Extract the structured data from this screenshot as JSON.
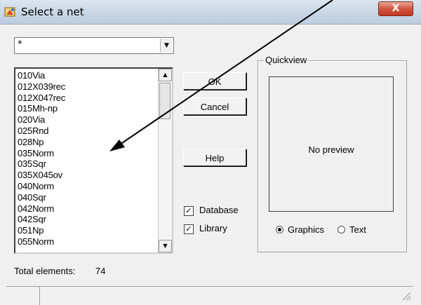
{
  "window": {
    "title": "Select a net",
    "close_label": "X"
  },
  "filter": {
    "value": "*"
  },
  "net_list": {
    "items": [
      "010Via",
      "012X039rec",
      "012X047rec",
      "015Mh-np",
      "020Via",
      "025Rnd",
      "028Np",
      "035Norm",
      "035Sqr",
      "035X045ov",
      "040Norm",
      "040Sqr",
      "042Norm",
      "042Sqr",
      "051Np",
      "055Norm"
    ]
  },
  "buttons": {
    "ok": "OK",
    "cancel": "Cancel",
    "help": "Help"
  },
  "checkboxes": {
    "database": {
      "label": "Database",
      "checked": true
    },
    "library": {
      "label": "Library",
      "checked": true
    }
  },
  "quickview": {
    "title": "Quickview",
    "preview_text": "No preview",
    "radio_graphics": "Graphics",
    "radio_text": "Text",
    "selected": "Graphics"
  },
  "footer": {
    "total_label": "Total elements:",
    "total_value": "74"
  },
  "colors": {
    "annotation_arrow": "#000000",
    "close_button": "#c1361e"
  }
}
